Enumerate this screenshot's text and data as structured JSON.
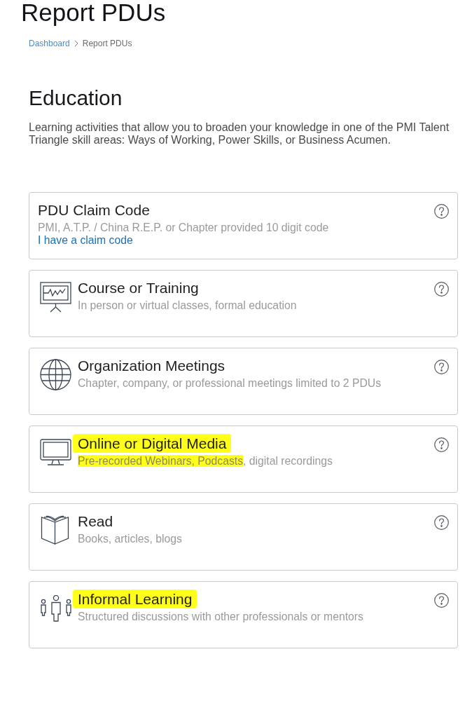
{
  "page": {
    "title": "Report PDUs"
  },
  "breadcrumb": [
    {
      "label": "Dashboard",
      "kind": "link"
    },
    {
      "label": "Report PDUs",
      "kind": "current"
    }
  ],
  "section": {
    "heading": "Education",
    "description": "Learning activities that allow you to broaden your knowledge in one of the PMI Talent Triangle skill areas: Ways of Working, Power Skills, or Business Acumen."
  },
  "options": [
    {
      "kind": "claim_code",
      "title": "PDU Claim Code",
      "highlighted": false,
      "subtitle": [
        {
          "text": "PMI, A.T.P. / China R.E.P. or Chapter provided 10 digit code",
          "highlighted": false
        }
      ],
      "link": "I have a claim code"
    },
    {
      "kind": "course",
      "title": "Course or Training",
      "highlighted": false,
      "subtitle": [
        {
          "text": "In person or virtual classes, formal education",
          "highlighted": false
        }
      ]
    },
    {
      "kind": "meetings",
      "title": "Organization Meetings",
      "highlighted": false,
      "subtitle": [
        {
          "text": "Chapter, company, or professional meetings limited to 2 PDUs",
          "highlighted": false
        }
      ]
    },
    {
      "kind": "digital_media",
      "title": "Online or Digital Media",
      "highlighted": true,
      "subtitle": [
        {
          "text": "Pre-recorded Webinars, Podcasts",
          "highlighted": true
        },
        {
          "text": ", digital recordings",
          "highlighted": false
        }
      ]
    },
    {
      "kind": "read",
      "title": "Read",
      "highlighted": false,
      "subtitle": [
        {
          "text": "Books, articles, blogs",
          "highlighted": false
        }
      ]
    },
    {
      "kind": "informal",
      "title": "Informal Learning",
      "highlighted": true,
      "subtitle": [
        {
          "text": "Structured discussions with other professionals or mentors",
          "highlighted": false
        }
      ]
    }
  ]
}
